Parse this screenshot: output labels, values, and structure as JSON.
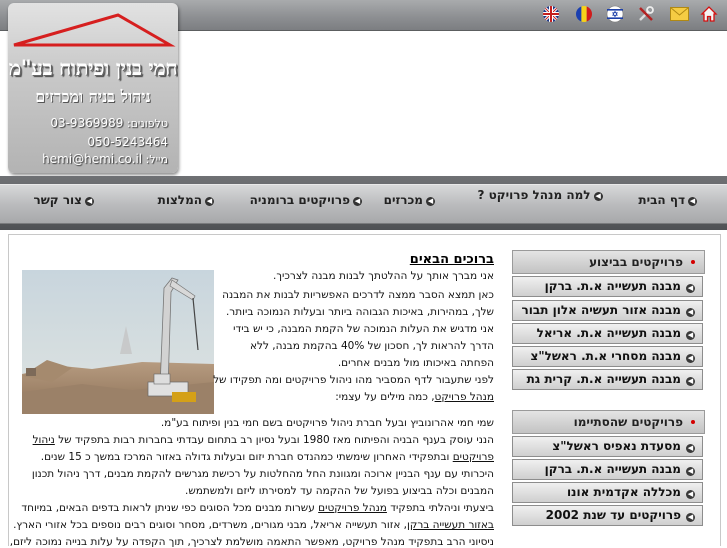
{
  "topbar": {
    "icons": [
      "home-icon",
      "mail-icon",
      "tools-icon",
      "israel-flag-icon",
      "romania-flag-icon",
      "uk-flag-icon"
    ]
  },
  "logo": {
    "line1": "חמי בנין ופיתוח בע\"מ",
    "line2": "ניהול בניה ומכרזים",
    "phone_label": "טלפונים:",
    "phone1": "03-9369989",
    "phone2": "050-5243464",
    "email_label": "מייל:",
    "email": "hemi@hemi.co.il"
  },
  "nav": {
    "home": "דף הבית",
    "why_pm": "למה מנהל פרויקט ?",
    "tenders": "מכרזים",
    "romania": "פרויקטים ברומניה",
    "recommendations": "המלצות",
    "contact": "צור קשר"
  },
  "main": {
    "title": "ברוכים הבאים",
    "lines": [
      "אני מברך אותך על ההלטתך לבנות מבנה לצרכיך.",
      "כאן תמצא הסבר ממצה לדרכים האפשריות לבנות את המבנה",
      "שלך, במהירות, באיכות הגבוהה ביותר ובעלות הנמוכה ביותר.",
      "אני מדגיש את העלות הנמוכה של הקמת המבנה, כי יש בידי",
      "הדרך להראות לך, חסכון של 40% בהקמת מבנה, ללא",
      "הפחתה באיכותו מול מבנים אחרים.",
      "לפני שתעבור לדף המסביר מהו ניהול פרויקטים ומה תפקידו של",
      "מנהל פרויקט",
      ", כמה מילים על עצמי:",
      "שמי חמי אהרונוביץ ובעל חברת ניהול פרויקטים בשם חמי בנין ופיתוח בע\"מ.",
      "הנני עוסק בענף הבניה והפיתוח מאז 1980 ובעל נסיון רב בתחום עבדתי בחברות רבות בתפקיד של",
      "ניהול",
      "פרויקטים",
      "ובתפקידי האחרון שימשתי כמהנדס חברת יזום ובעלות גדולה באזור המרכז במשך כ 15 שנים.",
      "היכרותי עם ענף הבניין ארוכה ומגוונת החל מהחלטות על רכישת מגרשים להקמת מבנים, דרך ניהול תכנון",
      "המבנים וכלה בביצוע בפועל של ההקמה עד למסירתו ליזם ולמשתמש.",
      "ביצעתי וניהלתי בתפקיד",
      "מנהל פרויקטים",
      "עשרות מבנים מכל הסוגים כפי שניתן לראות בדפים הבאים, במיוחד",
      "באזור תעשייה ברקן",
      ", אזור תעשייה אריאל, מבני מגורים, משרדים, מסחר וסוגים רבים נוספים בכל אזורי הארץ.",
      "ניסיוני הרב בתפקיד מנהל פרויקט, מאפשר התאמה מושלמת לצרכיך, תוך הקפדה על עלות בנייה נמוכה ליזם,"
    ]
  },
  "sidebar": {
    "in_progress_title": "פרויקטים בביצוע",
    "in_progress": [
      "מבנה תעשייה א.ת. ברקן",
      "מבנה אזור תעשיה אלון תבור",
      "מבנה תעשייה א.ת. אריאל",
      "מבנה מסחרי א.ת. ראשל\"צ",
      "מבנה תעשייה א.ת. קרית גת"
    ],
    "completed_title": "פרויקטים שהסתיימו",
    "completed": [
      "מסעדת נאפיס ראשל\"צ",
      "מבנה תעשייה א.ת. ברקן",
      "מכללה אקדמית אונו",
      "פרויקטים עד שנת 2002"
    ]
  },
  "colors": {
    "accent_red": "#d30000",
    "nav_bg": "#bbbcbe",
    "topbar_bg": "#8e9093"
  }
}
